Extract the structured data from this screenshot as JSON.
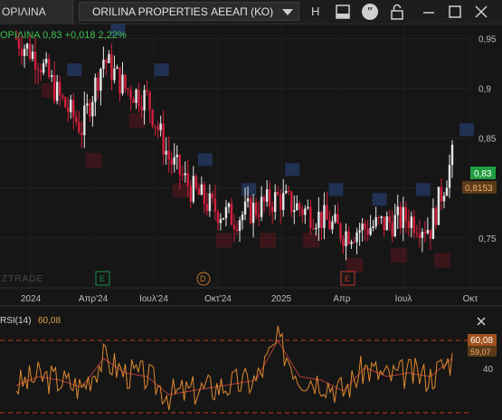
{
  "topbar": {
    "tab_label": "ΟΡΙΛΙΝΑ",
    "symbol_title": "ORILINA PROPERTIES ΑΕΕΑΠ (ΚΟ)",
    "h_label": "H"
  },
  "price_chart": {
    "legend": "ΟΡΙΛΙΝΑ 0,83 +0,018 2,22%",
    "watermark": "ZTRADE",
    "last_price_badge": "0,83",
    "prev_value_badge": "0,8153",
    "event_markers": [
      "E",
      "D",
      "E"
    ],
    "colors": {
      "up": "#e6e6e6",
      "down": "#d21f3c",
      "band": "#23365e",
      "dividend_band": "#5c1620",
      "last": "#1f9d3f",
      "prev": "#9a5a21"
    }
  },
  "rsi_panel": {
    "label": "RSI(14)",
    "value_text": "60,08",
    "badge_main": "60,08",
    "badge_sub": "59,07",
    "y_tick": "40"
  },
  "chart_data": {
    "type": "line",
    "title": "",
    "x_ticks": [
      "2024",
      "Απρ'24",
      "Ιουλ'24",
      "Οκτ'24",
      "2025",
      "Απρ",
      "Ιουλ",
      "Οκτ"
    ],
    "y_ticks": [
      "0,95",
      "0,9",
      "0,85",
      "0,8",
      "0,75"
    ],
    "ylim": [
      0.7,
      0.965
    ],
    "series": [
      {
        "name": "ΟΡΙΛΙΝΑ",
        "x": [
          "2024-01",
          "2024-02",
          "2024-03",
          "2024-04",
          "2024-05",
          "2024-06",
          "2024-07",
          "2024-08",
          "2024-09",
          "2024-10",
          "2024-11",
          "2024-12",
          "2025-01",
          "2025-02",
          "2025-03",
          "2025-04",
          "2025-05",
          "2025-06",
          "2025-07",
          "2025-08",
          "2025-09"
        ],
        "values": [
          0.95,
          0.93,
          0.89,
          0.86,
          0.93,
          0.9,
          0.89,
          0.83,
          0.8,
          0.78,
          0.77,
          0.78,
          0.79,
          0.78,
          0.77,
          0.755,
          0.76,
          0.765,
          0.77,
          0.76,
          0.83
        ]
      }
    ],
    "rsi": {
      "name": "RSI(14)",
      "x": [
        "2024-01",
        "2024-02",
        "2024-03",
        "2024-04",
        "2024-05",
        "2024-06",
        "2024-07",
        "2024-08",
        "2024-09",
        "2024-10",
        "2024-11",
        "2024-12",
        "2025-01",
        "2025-02",
        "2025-03",
        "2025-04",
        "2025-05",
        "2025-06",
        "2025-07",
        "2025-08",
        "2025-09"
      ],
      "values": [
        45,
        50,
        48,
        44,
        60,
        52,
        50,
        40,
        42,
        44,
        46,
        48,
        70,
        50,
        48,
        42,
        55,
        50,
        52,
        50,
        60.08
      ],
      "ylim": [
        20,
        80
      ],
      "levels": [
        70,
        30
      ]
    }
  }
}
